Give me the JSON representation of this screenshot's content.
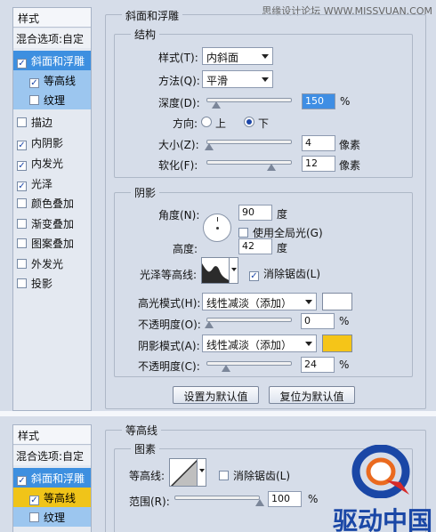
{
  "watermark": "思缘设计论坛 WWW.MISSVUAN.COM",
  "panel1": {
    "styles_title": "样式",
    "blend_options": "混合选项:自定",
    "items": [
      {
        "label": "斜面和浮雕",
        "checked": true
      },
      {
        "label": "等高线",
        "checked": true
      },
      {
        "label": "纹理",
        "checked": false
      },
      {
        "label": "描边",
        "checked": false
      },
      {
        "label": "内阴影",
        "checked": true
      },
      {
        "label": "内发光",
        "checked": true
      },
      {
        "label": "光泽",
        "checked": true
      },
      {
        "label": "颜色叠加",
        "checked": false
      },
      {
        "label": "渐变叠加",
        "checked": false
      },
      {
        "label": "图案叠加",
        "checked": false
      },
      {
        "label": "外发光",
        "checked": false
      },
      {
        "label": "投影",
        "checked": false
      }
    ],
    "section_title": "斜面和浮雕",
    "structure": {
      "title": "结构",
      "style_label": "样式(T):",
      "style_value": "内斜面",
      "technique_label": "方法(Q):",
      "technique_value": "平滑",
      "depth_label": "深度(D):",
      "depth_value": "150",
      "depth_unit": "%",
      "direction_label": "方向:",
      "direction_up": "上",
      "direction_down": "下",
      "direction_selected": "下",
      "size_label": "大小(Z):",
      "size_value": "4",
      "size_unit": "像素",
      "soften_label": "软化(F):",
      "soften_value": "12",
      "soften_unit": "像素"
    },
    "shading": {
      "title": "阴影",
      "angle_label": "角度(N):",
      "angle_value": "90",
      "angle_unit": "度",
      "global_light_label": "使用全局光(G)",
      "global_light_checked": false,
      "altitude_label": "高度:",
      "altitude_value": "42",
      "altitude_unit": "度",
      "gloss_label": "光泽等高线:",
      "antialias_label": "消除锯齿(L)",
      "antialias_checked": true,
      "highlight_label": "高光模式(H):",
      "highlight_value": "线性减淡（添加）",
      "highlight_color": "#ffffff",
      "opacity1_label": "不透明度(O):",
      "opacity1_value": "0",
      "opacity1_unit": "%",
      "shadow_label": "阴影模式(A):",
      "shadow_value": "线性减淡（添加）",
      "shadow_color": "#f5c518",
      "opacity2_label": "不透明度(C):",
      "opacity2_value": "24",
      "opacity2_unit": "%"
    },
    "buttons": {
      "make_default": "设置为默认值",
      "reset_default": "复位为默认值"
    }
  },
  "panel2": {
    "styles_title": "样式",
    "blend_options": "混合选项:自定",
    "items": [
      {
        "label": "斜面和浮雕",
        "checked": true
      },
      {
        "label": "等高线",
        "checked": true
      },
      {
        "label": "纹理",
        "checked": false
      }
    ],
    "section_title": "等高线",
    "elements_title": "图素",
    "contour_label": "等高线:",
    "antialias_label": "消除锯齿(L)",
    "antialias_checked": false,
    "range_label": "范围(R):",
    "range_value": "100",
    "range_unit": "%"
  },
  "logo_text": "驱动中国"
}
